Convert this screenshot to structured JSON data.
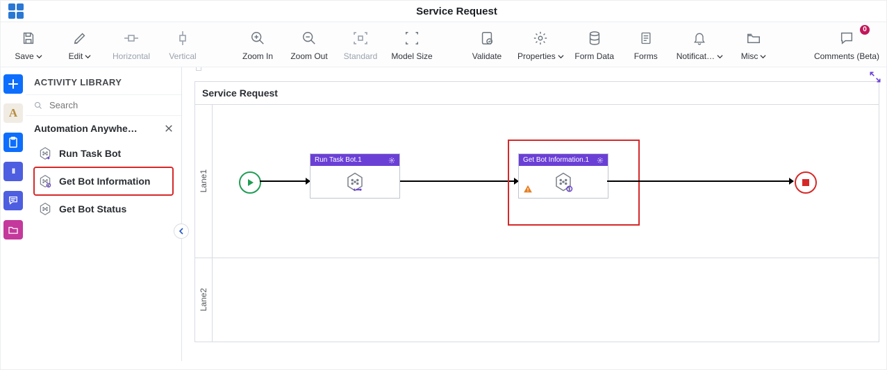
{
  "title": "Service Request",
  "toolbar": {
    "save": "Save",
    "edit": "Edit",
    "horizontal": "Horizontal",
    "vertical": "Vertical",
    "zoom_in": "Zoom In",
    "zoom_out": "Zoom Out",
    "standard": "Standard",
    "model_size": "Model Size",
    "validate": "Validate",
    "properties": "Properties",
    "form_data": "Form Data",
    "forms": "Forms",
    "notifications": "Notificat…",
    "misc": "Misc",
    "comments": "Comments (Beta)",
    "comments_count": "0"
  },
  "library": {
    "heading": "ACTIVITY LIBRARY",
    "search_placeholder": "Search",
    "group_name": "Automation Anywhe…",
    "items": [
      {
        "label": "Run Task Bot",
        "selected": false
      },
      {
        "label": "Get Bot Information",
        "selected": true
      },
      {
        "label": "Get Bot Status",
        "selected": false
      }
    ]
  },
  "process": {
    "title": "Service Request",
    "lanes": [
      "Lane1",
      "Lane2"
    ],
    "nodes": [
      {
        "title": "Run Task Bot.1",
        "warn": false
      },
      {
        "title": "Get Bot Information.1",
        "warn": true
      }
    ]
  }
}
